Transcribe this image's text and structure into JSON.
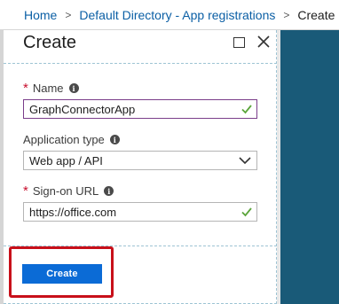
{
  "breadcrumb": {
    "home": "Home",
    "parent": "Default Directory - App registrations",
    "current": "Create",
    "separator": ">"
  },
  "blade": {
    "title": "Create",
    "maximize_icon": "maximize-icon",
    "close_icon": "close-icon"
  },
  "form": {
    "name": {
      "label": "Name",
      "required": true,
      "value": "GraphConnectorApp",
      "valid": true
    },
    "application_type": {
      "label": "Application type",
      "selected": "Web app / API"
    },
    "sign_on_url": {
      "label": "Sign-on URL",
      "required": true,
      "value": "https://office.com",
      "valid": true
    }
  },
  "footer": {
    "create_label": "Create"
  },
  "colors": {
    "accent": "#0b6bd6",
    "link": "#0b5fa5",
    "required": "#c8102e",
    "valid_check": "#5ba53b",
    "focus_border": "#7a3d8a",
    "side_pane": "#195a78",
    "highlight": "#c8101a"
  }
}
